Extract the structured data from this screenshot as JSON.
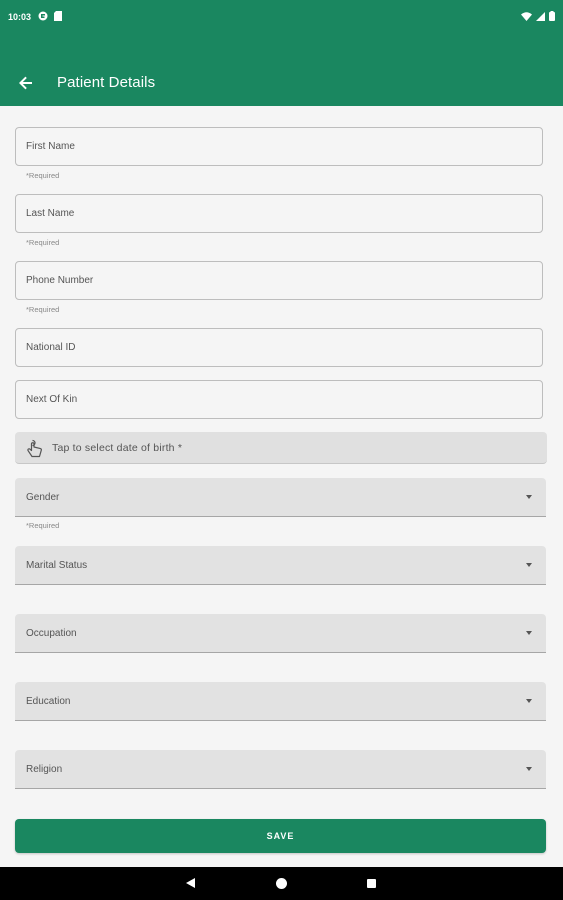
{
  "status_bar": {
    "time": "10:03",
    "left_icons": [
      "app-notification-icon",
      "sd-card-icon"
    ],
    "right_icons": [
      "wifi-icon",
      "signal-icon",
      "battery-icon"
    ]
  },
  "app_bar": {
    "title": "Patient Details",
    "back_icon": "arrow-back-icon"
  },
  "form": {
    "first_name": {
      "placeholder": "First Name",
      "helper": "*Required"
    },
    "last_name": {
      "placeholder": "Last Name",
      "helper": "*Required"
    },
    "phone_number": {
      "placeholder": "Phone Number",
      "helper": "*Required"
    },
    "national_id": {
      "placeholder": "National ID"
    },
    "next_of_kin": {
      "placeholder": "Next Of Kin"
    },
    "date_of_birth": {
      "label": "Tap to select date of birth *",
      "icon": "touch-icon"
    },
    "gender": {
      "label": "Gender",
      "helper": "*Required"
    },
    "marital_status": {
      "label": "Marital Status"
    },
    "occupation": {
      "label": "Occupation"
    },
    "education": {
      "label": "Education"
    },
    "religion": {
      "label": "Religion"
    },
    "save_label": "SAVE"
  },
  "colors": {
    "primary": "#1a8760",
    "background": "#f5f5f5",
    "select_fill": "#e2e2e2"
  },
  "nav_bar": {
    "icons": [
      "nav-back-icon",
      "nav-home-icon",
      "nav-recents-icon"
    ]
  }
}
